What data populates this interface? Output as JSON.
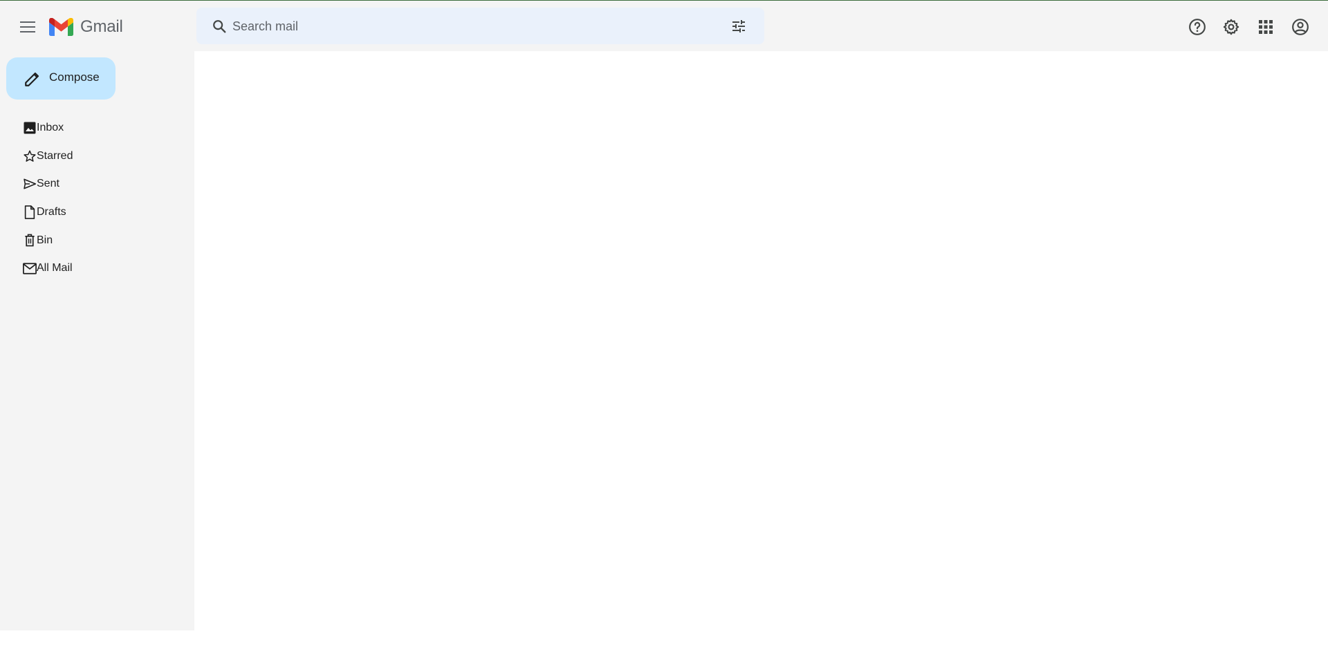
{
  "app": {
    "name": "Gmail",
    "brand_colors": {
      "red": "#ea4335",
      "blue": "#4285f4",
      "green": "#34a853",
      "yellow": "#fbbc04",
      "dark_red": "#c5221f"
    }
  },
  "header": {
    "menu_icon": "hamburger-menu-icon",
    "logo_text": "Gmail",
    "search": {
      "placeholder": "Search mail",
      "value": "",
      "filter_icon": "tune-icon"
    },
    "icons": [
      "help-icon",
      "settings-gear-icon",
      "apps-grid-icon",
      "account-circle-icon"
    ]
  },
  "sidebar": {
    "compose_label": "Compose",
    "compose_color": "#c2e7ff",
    "items": [
      {
        "label": "Inbox",
        "icon": "inbox-image-icon"
      },
      {
        "label": "Starred",
        "icon": "star-icon"
      },
      {
        "label": "Sent",
        "icon": "send-icon"
      },
      {
        "label": "Drafts",
        "icon": "draft-file-icon"
      },
      {
        "label": "Bin",
        "icon": "trash-icon"
      },
      {
        "label": "All Mail",
        "icon": "mail-icon"
      }
    ]
  }
}
